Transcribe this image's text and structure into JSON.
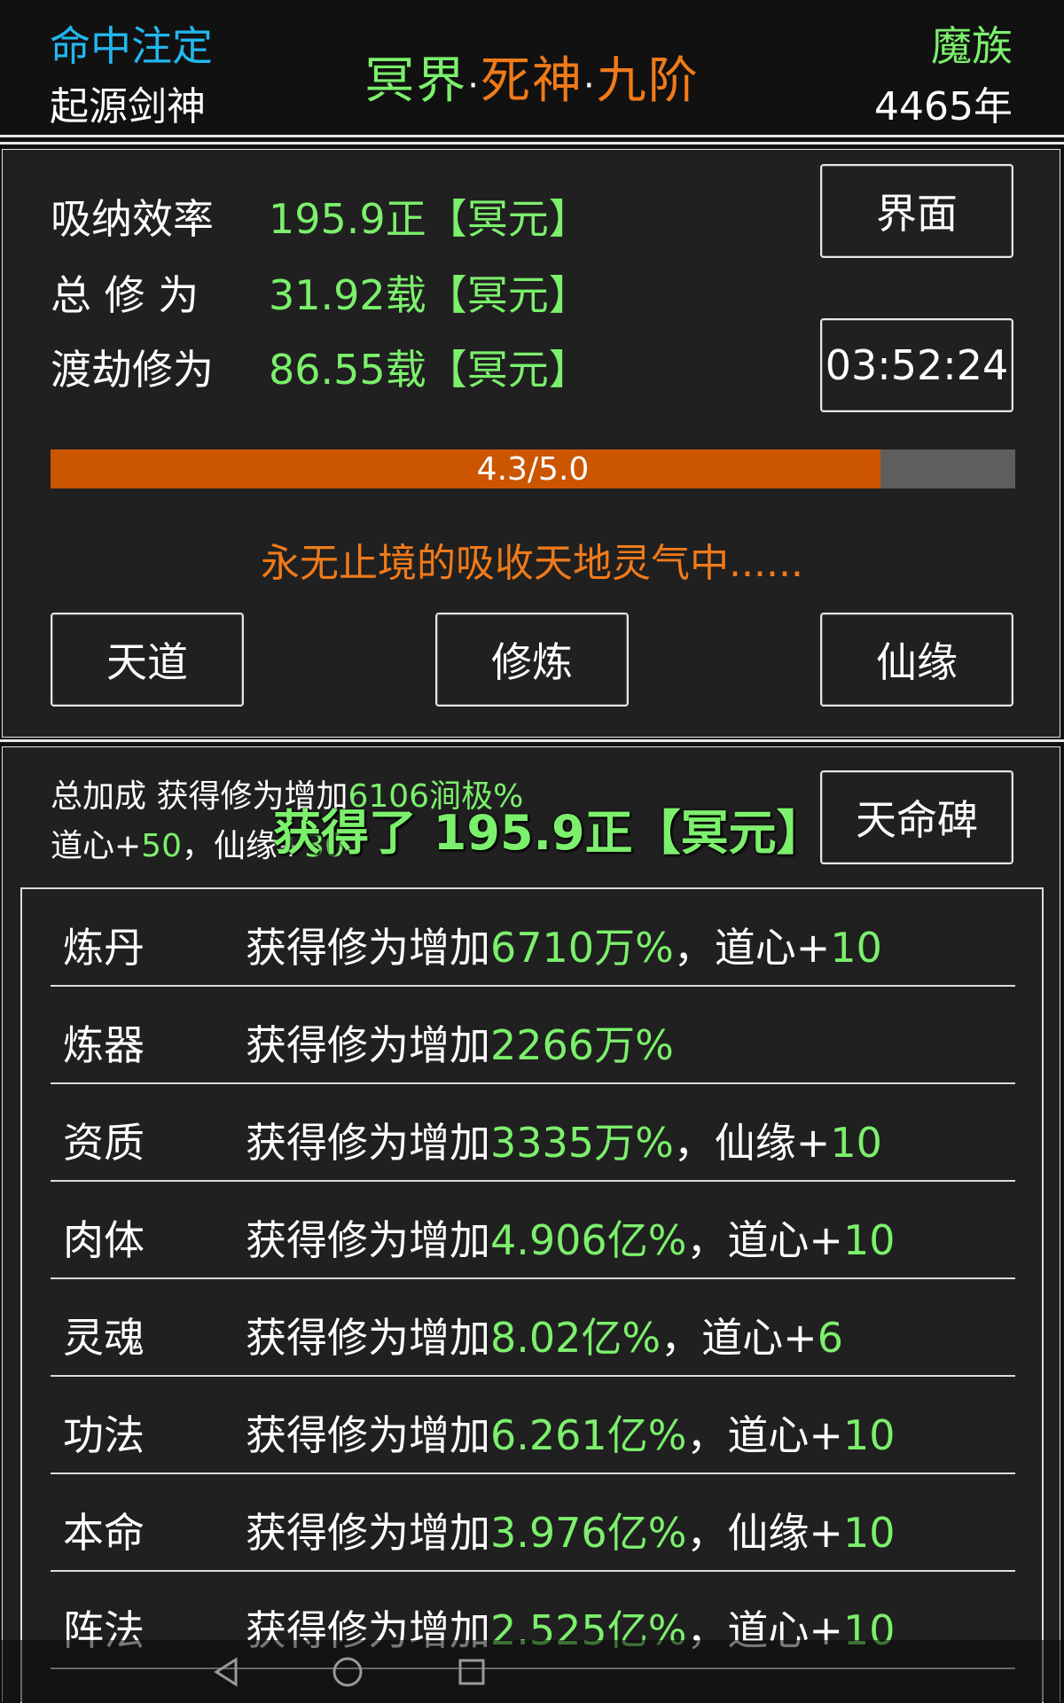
{
  "header": {
    "destiny_label": "命中注定",
    "player_title": "起源剑神",
    "realm": {
      "part1": "冥界",
      "dot1": "·",
      "part2": "死神",
      "dot2": "·",
      "part3": "九阶"
    },
    "race": "魔族",
    "age": "4465年"
  },
  "stats": [
    {
      "label": "吸纳效率",
      "value": "195.9正【冥元】"
    },
    {
      "label": "总 修 为",
      "value": "31.92载【冥元】"
    },
    {
      "label": "渡劫修为",
      "value": "86.55载【冥元】"
    }
  ],
  "buttons": {
    "interface": "界面",
    "timer": "03:52:24",
    "tiandao": "天道",
    "xiulian": "修炼",
    "xianyuan": "仙缘",
    "tianmingbei": "天命碑"
  },
  "progress": {
    "text": "4.3/5.0",
    "value": 4.3,
    "max": 5.0
  },
  "status_message": "永无止境的吸收天地灵气中......",
  "total_bonus": {
    "prefix": "总加成 获得修为增加",
    "value": "6106涧极%",
    "daoxin_label": "道心+",
    "daoxin_value": "50",
    "sep": "，仙缘+",
    "xianyuan_value": "30"
  },
  "gain_popup": "获得了 195.9正【冥元】",
  "bonus_rows": [
    {
      "category": "炼丹",
      "prefix": "获得修为增加",
      "value": "6710万%",
      "suffix": "，道心+",
      "extra": "10"
    },
    {
      "category": "炼器",
      "prefix": "获得修为增加",
      "value": "2266万%",
      "suffix": "",
      "extra": ""
    },
    {
      "category": "资质",
      "prefix": "获得修为增加",
      "value": "3335万%",
      "suffix": "，仙缘+",
      "extra": "10"
    },
    {
      "category": "肉体",
      "prefix": "获得修为增加",
      "value": "4.906亿%",
      "suffix": "，道心+",
      "extra": "10"
    },
    {
      "category": "灵魂",
      "prefix": "获得修为增加",
      "value": "8.02亿%",
      "suffix": "，道心+",
      "extra": "6"
    },
    {
      "category": "功法",
      "prefix": "获得修为增加",
      "value": "6.261亿%",
      "suffix": "，道心+",
      "extra": "10"
    },
    {
      "category": "本命",
      "prefix": "获得修为增加",
      "value": "3.976亿%",
      "suffix": "，仙缘+",
      "extra": "10"
    },
    {
      "category": "阵法",
      "prefix": "获得修为增加",
      "value": "2.525亿%",
      "suffix": "，道心+",
      "extra": "10"
    }
  ],
  "nav": {
    "back": "back-icon",
    "home": "home-icon",
    "recents": "recents-icon"
  }
}
